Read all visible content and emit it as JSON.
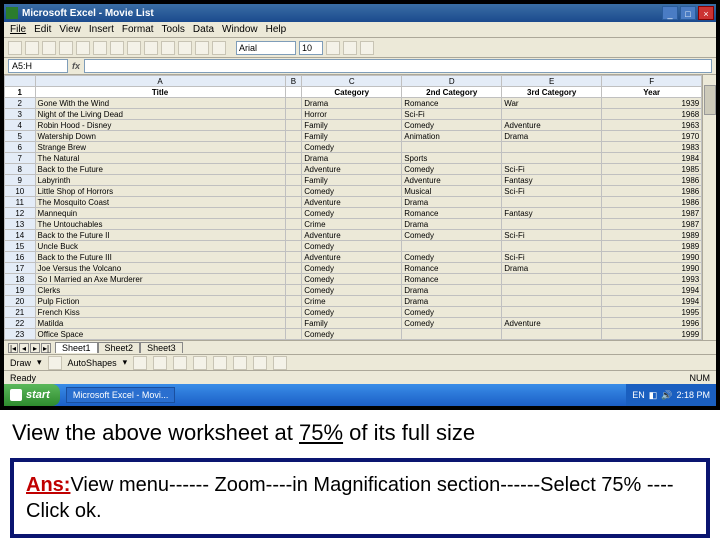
{
  "titlebar": {
    "app": "Microsoft Excel",
    "doc": "Movie List"
  },
  "menus": [
    "File",
    "Edit",
    "View",
    "Insert",
    "Format",
    "Tools",
    "Data",
    "Window",
    "Help"
  ],
  "toolbar": {
    "font": "Arial",
    "size": "10"
  },
  "namebox": "A5:H",
  "columns": [
    "",
    "A",
    "B",
    "C",
    "D",
    "E",
    "F"
  ],
  "headers": {
    "A": "Title",
    "C": "Category",
    "D": "2nd Category",
    "E": "3rd Category",
    "F": "Year"
  },
  "rows": [
    {
      "n": "2",
      "a": "Gone With the Wind",
      "c": "Drama",
      "d": "Romance",
      "e": "War",
      "f": "1939"
    },
    {
      "n": "3",
      "a": "Night of the Living Dead",
      "c": "Horror",
      "d": "Sci-Fi",
      "e": "",
      "f": "1968"
    },
    {
      "n": "4",
      "a": "Robin Hood - Disney",
      "c": "Family",
      "d": "Comedy",
      "e": "Adventure",
      "f": "1963"
    },
    {
      "n": "5",
      "a": "Watership Down",
      "c": "Family",
      "d": "Animation",
      "e": "Drama",
      "f": "1970"
    },
    {
      "n": "6",
      "a": "Strange Brew",
      "c": "Comedy",
      "d": "",
      "e": "",
      "f": "1983"
    },
    {
      "n": "7",
      "a": "The Natural",
      "c": "Drama",
      "d": "Sports",
      "e": "",
      "f": "1984"
    },
    {
      "n": "8",
      "a": "Back to the Future",
      "c": "Adventure",
      "d": "Comedy",
      "e": "Sci-Fi",
      "f": "1985"
    },
    {
      "n": "9",
      "a": "Labyrinth",
      "c": "Family",
      "d": "Adventure",
      "e": "Fantasy",
      "f": "1986"
    },
    {
      "n": "10",
      "a": "Little Shop of Horrors",
      "c": "Comedy",
      "d": "Musical",
      "e": "Sci-Fi",
      "f": "1986"
    },
    {
      "n": "11",
      "a": "The Mosquito Coast",
      "c": "Adventure",
      "d": "Drama",
      "e": "",
      "f": "1986"
    },
    {
      "n": "12",
      "a": "Mannequin",
      "c": "Comedy",
      "d": "Romance",
      "e": "Fantasy",
      "f": "1987"
    },
    {
      "n": "13",
      "a": "The Untouchables",
      "c": "Crime",
      "d": "Drama",
      "e": "",
      "f": "1987"
    },
    {
      "n": "14",
      "a": "Back to the Future II",
      "c": "Adventure",
      "d": "Comedy",
      "e": "Sci-Fi",
      "f": "1989"
    },
    {
      "n": "15",
      "a": "Uncle Buck",
      "c": "Comedy",
      "d": "",
      "e": "",
      "f": "1989"
    },
    {
      "n": "16",
      "a": "Back to the Future III",
      "c": "Adventure",
      "d": "Comedy",
      "e": "Sci-Fi",
      "f": "1990"
    },
    {
      "n": "17",
      "a": "Joe Versus the Volcano",
      "c": "Comedy",
      "d": "Romance",
      "e": "Drama",
      "f": "1990"
    },
    {
      "n": "18",
      "a": "So I Married an Axe Murderer",
      "c": "Comedy",
      "d": "Romance",
      "e": "",
      "f": "1993"
    },
    {
      "n": "19",
      "a": "Clerks",
      "c": "Comedy",
      "d": "Drama",
      "e": "",
      "f": "1994"
    },
    {
      "n": "20",
      "a": "Pulp Fiction",
      "c": "Crime",
      "d": "Drama",
      "e": "",
      "f": "1994"
    },
    {
      "n": "21",
      "a": "French Kiss",
      "c": "Comedy",
      "d": "Comedy",
      "e": "",
      "f": "1995"
    },
    {
      "n": "22",
      "a": "Matilda",
      "c": "Family",
      "d": "Comedy",
      "e": "Adventure",
      "f": "1996"
    },
    {
      "n": "23",
      "a": "Office Space",
      "c": "Comedy",
      "d": "",
      "e": "",
      "f": "1999"
    }
  ],
  "sheets": [
    "Sheet1",
    "Sheet2",
    "Sheet3"
  ],
  "drawbar": {
    "draw": "Draw",
    "autoshapes": "AutoShapes"
  },
  "status": {
    "ready": "Ready",
    "num": "NUM"
  },
  "taskbar": {
    "start": "start",
    "task": "Microsoft Excel - Movi...",
    "lang": "EN",
    "time": "2:18 PM"
  },
  "question": {
    "pre": "View the above worksheet at ",
    "pct": "75%",
    "post": " of its full size"
  },
  "answer": {
    "label": "Ans:",
    "text": "View menu------ Zoom----in Magnification section------Select 75% ----Click ok."
  }
}
